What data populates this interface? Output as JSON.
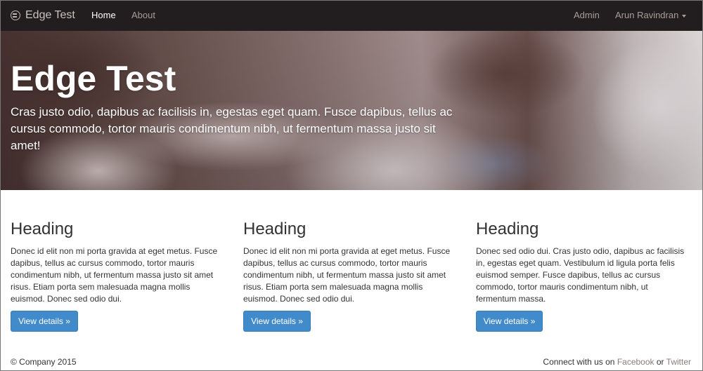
{
  "navbar": {
    "brand": "Edge Test",
    "home": "Home",
    "about": "About",
    "admin": "Admin",
    "user": "Arun Ravindran"
  },
  "hero": {
    "title": "Edge Test",
    "text": "Cras justo odio, dapibus ac facilisis in, egestas eget quam. Fusce dapibus, tellus ac cursus commodo, tortor mauris condimentum nibh, ut fermentum massa justo sit amet!"
  },
  "columns": [
    {
      "heading": "Heading",
      "text": "Donec id elit non mi porta gravida at eget metus. Fusce dapibus, tellus ac cursus commodo, tortor mauris condimentum nibh, ut fermentum massa justo sit amet risus. Etiam porta sem malesuada magna mollis euismod. Donec sed odio dui.",
      "button": "View details »"
    },
    {
      "heading": "Heading",
      "text": "Donec id elit non mi porta gravida at eget metus. Fusce dapibus, tellus ac cursus commodo, tortor mauris condimentum nibh, ut fermentum massa justo sit amet risus. Etiam porta sem malesuada magna mollis euismod. Donec sed odio dui.",
      "button": "View details »"
    },
    {
      "heading": "Heading",
      "text": "Donec sed odio dui. Cras justo odio, dapibus ac facilisis in, egestas eget quam. Vestibulum id ligula porta felis euismod semper. Fusce dapibus, tellus ac cursus commodo, tortor mauris condimentum nibh, ut fermentum massa.",
      "button": "View details »"
    }
  ],
  "footer": {
    "copyright": "© Company 2015",
    "connect_prefix": "Connect with us on",
    "facebook": "Facebook",
    "or": "or",
    "twitter": "Twitter"
  },
  "colors": {
    "navbar_bg": "#221e1f",
    "button_bg": "#428bca",
    "link": "#8a7d7a"
  },
  "icons": {
    "brand": "brand-logo-icon",
    "dropdown": "caret-down-icon"
  }
}
